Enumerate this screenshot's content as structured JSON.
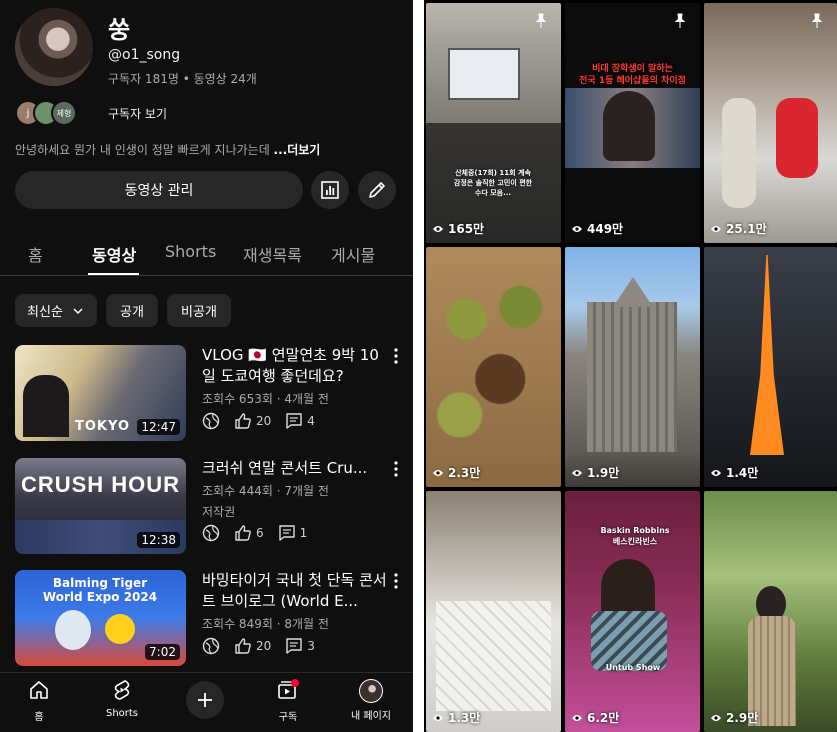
{
  "channel": {
    "name": "쑹",
    "handle": "@o1_song",
    "stats": "구독자 181명 • 동영상 24개",
    "subscribers_link": "구독자 보기",
    "sub_avatar_letters": [
      "j",
      "",
      "제형"
    ],
    "description": "안녕하세요 뭔가 내 인생이 정말 빠르게 지나가는데 ",
    "more": "...더보기",
    "manage_label": "동영상 관리"
  },
  "tabs": [
    "홈",
    "동영상",
    "Shorts",
    "재생목록",
    "게시물"
  ],
  "active_tab": "동영상",
  "chips": [
    {
      "label": "최신순",
      "has_dropdown": true
    },
    {
      "label": "공개"
    },
    {
      "label": "비공개"
    }
  ],
  "videos": [
    {
      "title": "VLOG 🇯🇵 연말연초 9박 10일 도쿄여행 좋던데요?",
      "meta": "조회수 653회 · 4개월 전",
      "meta2": "",
      "duration": "12:47",
      "likes": "20",
      "comments": "4",
      "thumb_text": "TOKYO"
    },
    {
      "title": "크러쉬 연말 콘서트 Cru...",
      "meta": "조회수 444회 · 7개월 전",
      "meta2": "저작권",
      "duration": "12:38",
      "likes": "6",
      "comments": "1",
      "thumb_text": "CRUSH HOUR"
    },
    {
      "title": "바밍타이거 국내 첫 단독 콘서트 브이로그 (World E...",
      "meta": "조회수 849회 · 8개월 전",
      "meta2": "",
      "duration": "7:02",
      "likes": "20",
      "comments": "3",
      "thumb_text": "Balming Tiger World Expo 2024"
    }
  ],
  "nav": {
    "home": "홈",
    "shorts": "Shorts",
    "subscriptions": "구독",
    "my_page": "내 페이지"
  },
  "shorts": [
    {
      "views": "165만",
      "pinned": true,
      "overlay": "산체중(17회) 11회 계속\n감정은 솔직한 고민이 편한\n수다 모음..."
    },
    {
      "views": "449만",
      "pinned": true,
      "overlay": "비대 장학생이 말하는\n전국 1등 헤어샵들의 차이점"
    },
    {
      "views": "25.1만",
      "pinned": true,
      "overlay": ""
    },
    {
      "views": "2.3만",
      "pinned": false,
      "overlay": ""
    },
    {
      "views": "1.9만",
      "pinned": false,
      "overlay": ""
    },
    {
      "views": "1.4만",
      "pinned": false,
      "overlay": ""
    },
    {
      "views": "1.3만",
      "pinned": false,
      "overlay": ""
    },
    {
      "views": "6.2만",
      "pinned": false,
      "overlay": "Baskin Robbins\n베스킨라빈스",
      "overlay2": "Untub Show"
    },
    {
      "views": "2.9만",
      "pinned": false,
      "overlay": ""
    }
  ]
}
